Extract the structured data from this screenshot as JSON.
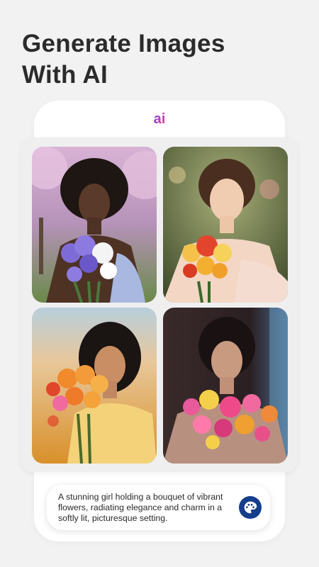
{
  "headline": {
    "line1": "Generate Images",
    "line2": "With AI"
  },
  "app": {
    "logo_text": "ai",
    "logo_icon": "ai-logo-icon"
  },
  "gallery": {
    "tiles": [
      {
        "name": "generated-image-1",
        "palette": [
          "#c7a2c8",
          "#3a2a22",
          "#7d6bd6",
          "#b9c8e8"
        ]
      },
      {
        "name": "generated-image-2",
        "palette": [
          "#5a6a3e",
          "#e8c3a0",
          "#e2452b",
          "#f4c24a"
        ]
      },
      {
        "name": "generated-image-3",
        "palette": [
          "#e9a84a",
          "#1a1412",
          "#f08a2a",
          "#f3d27a"
        ]
      },
      {
        "name": "generated-image-4",
        "palette": [
          "#3a2a2a",
          "#2a1f1f",
          "#e85a9a",
          "#f4d04a"
        ]
      }
    ]
  },
  "prompt": {
    "text": "A stunning girl holding a bouquet of vibrant flowers, radiating elegance and charm in a softly lit, picturesque setting.",
    "icon": "palette-icon"
  },
  "colors": {
    "accent": "#143e8c",
    "background": "#f2f2f2"
  }
}
